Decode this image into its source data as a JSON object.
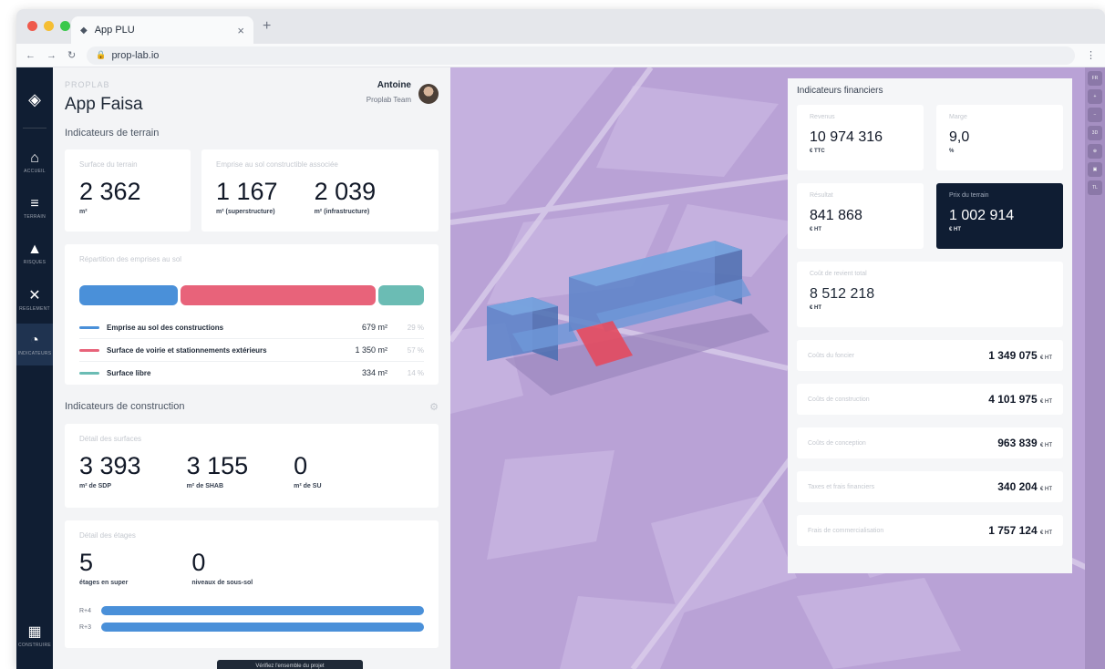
{
  "browser": {
    "tab_title": "App PLU",
    "close_glyph": "×",
    "new_tab_glyph": "+",
    "url": "prop-lab.io"
  },
  "rail": {
    "items": [
      {
        "icon": "home-icon",
        "glyph": "⌂",
        "label": "ACCUEIL"
      },
      {
        "icon": "layers-icon",
        "glyph": "≡",
        "label": "TERRAIN"
      },
      {
        "icon": "warning-icon",
        "glyph": "▲",
        "label": "RISQUES"
      },
      {
        "icon": "tools-icon",
        "glyph": "✕",
        "label": "REGLEMENT"
      },
      {
        "icon": "gauge-icon",
        "glyph": "◔",
        "label": "INDICATEURS"
      }
    ],
    "bottom": {
      "icon": "grid-icon",
      "glyph": "▦",
      "label": "CONSTRUIRE"
    }
  },
  "header": {
    "eyebrow": "PROPLAB",
    "title": "App Faisa",
    "user_name": "Antoine",
    "user_team": "Proplab Team"
  },
  "terrain": {
    "section_title": "Indicateurs de terrain",
    "surface_label": "Surface du terrain",
    "surface_value": "2 362",
    "surface_unit": "m²",
    "emprise_label": "Emprise au sol constructible associée",
    "super_value": "1 167",
    "super_unit": "m² (superstructure)",
    "infra_value": "2 039",
    "infra_unit": "m² (infrastructure)",
    "repartition_label": "Répartition des emprises au sol",
    "legend": [
      {
        "label": "Emprise au sol des constructions",
        "value": "679 m²",
        "pct": "29 %",
        "color": "#4a90d9"
      },
      {
        "label": "Surface de voirie et stationnements extérieurs",
        "value": "1 350 m²",
        "pct": "57 %",
        "color": "#e8637a"
      },
      {
        "label": "Surface libre",
        "value": "334 m²",
        "pct": "14 %",
        "color": "#6bbcb4"
      }
    ]
  },
  "construction": {
    "section_title": "Indicateurs de construction",
    "settings_glyph": "⚙",
    "surfaces_label": "Détail des surfaces",
    "sdp_value": "3 393",
    "sdp_unit": "m² de SDP",
    "shab_value": "3 155",
    "shab_unit": "m² de SHAB",
    "su_value": "0",
    "su_unit": "m² de SU",
    "etages_label": "Détail des étages",
    "etages_value": "5",
    "etages_unit": "étages en super",
    "sous_sol_value": "0",
    "sous_sol_unit": "niveaux de sous-sol",
    "floor_rows": [
      "R+4",
      "R+3"
    ],
    "toast": "Vérifiez l'ensemble du projet"
  },
  "finance": {
    "title": "Indicateurs financiers",
    "revenus_label": "Revenus",
    "revenus_value": "10 974 316",
    "revenus_unit": "€ TTC",
    "marge_label": "Marge",
    "marge_value": "9,0",
    "marge_unit": "%",
    "resultat_label": "Résultat",
    "resultat_value": "841 868",
    "resultat_unit": "€ HT",
    "prix_label": "Prix du terrain",
    "prix_value": "1 002 914",
    "prix_unit": "€ HT",
    "cout_label": "Coût de revient total",
    "cout_value": "8 512 218",
    "cout_unit": "€ HT",
    "rows": [
      {
        "label": "Coûts du foncier",
        "value": "1 349 075",
        "unit": "€ HT"
      },
      {
        "label": "Coûts de construction",
        "value": "4 101 975",
        "unit": "€ HT"
      },
      {
        "label": "Coûts de conception",
        "value": "963 839",
        "unit": "€ HT"
      },
      {
        "label": "Taxes et frais financiers",
        "value": "340 204",
        "unit": "€ HT"
      },
      {
        "label": "Frais de commercialisation",
        "value": "1 757 124",
        "unit": "€ HT"
      }
    ]
  },
  "minirail": [
    "FR",
    "+",
    "−",
    "3D",
    "⊕",
    "▣",
    "TL"
  ],
  "colors": {
    "accent_blue": "#4a90d9",
    "accent_red": "#e8637a",
    "accent_teal": "#6bbcb4",
    "navy": "#0f1d33",
    "map_purple": "#b9a2d6"
  }
}
